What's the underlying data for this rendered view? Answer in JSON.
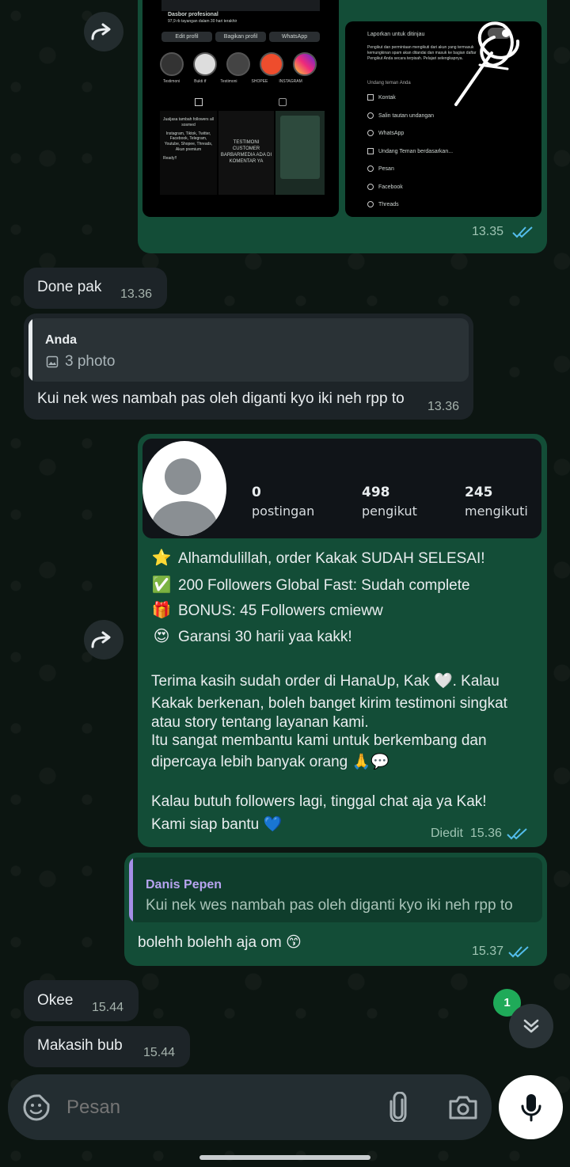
{
  "top_preview": {
    "left_thumb": {
      "header_title": "Dasbor profesional",
      "header_sub": "97,9 rb tayangan dalam 30 hari terakhir",
      "buttons": [
        "Edit profil",
        "Bagikan profil",
        "WhatsApp"
      ],
      "highlights": [
        "Testimoni",
        "Bukti tf",
        "Testimoni",
        "SHOPEE",
        "INSTAGRAM"
      ],
      "post_text_1": "Jualjasa tambah followers all sosmed",
      "post_text_2": "Instagram, Tiktok, Twitter, Facebook, Telegram, Youtube, Shopee, Threads, Akun premium",
      "post_text_3": "Ready!!",
      "post_text_4": "TESTIMONI CUSTOMER BARBARMEDIA ADA DI KOMENTAR YA"
    },
    "right_thumb": {
      "title": "Laporkan untuk ditinjau",
      "desc": "Pengikut dan permintaan mengikuti dari akun yang termasuk kemungkinan spam akan ditandai dan masuk ke bagian daftar Pengikut Anda secara terpisah. Pelajari selengkapnya.",
      "invite_title": "Undang teman Anda",
      "items": [
        "Kontak",
        "Salin tautan undangan",
        "WhatsApp",
        "Undang Teman berdasarkan...",
        "Pesan",
        "Facebook",
        "Threads"
      ]
    },
    "time": "13.35"
  },
  "messages": {
    "done": {
      "text": "Done pak",
      "time": "13.36"
    },
    "reply_in": {
      "quote_author": "Anda",
      "quote_text": "3 photo",
      "text": "Kui nek wes nambah pas oleh diganti kyo iki neh rpp to",
      "time": "13.36"
    },
    "order": {
      "profile": {
        "posts_num": "0",
        "posts_label": "postingan",
        "followers_num": "498",
        "followers_label": "pengikut",
        "following_num": "245",
        "following_label": "mengikuti"
      },
      "lines": [
        {
          "emoji": "⭐",
          "text": "Alhamdulillah, order Kakak SUDAH SELESAI!"
        },
        {
          "emoji": "✅",
          "text": "200 Followers Global Fast: Sudah complete"
        },
        {
          "emoji": "🎁",
          "text": "BONUS: 45 Followers cmieww"
        },
        {
          "emoji": "😍",
          "text": "Garansi 30 harii yaa kakk!"
        }
      ],
      "para1_l1": "Terima kasih sudah order di HanaUp, Kak 🤍. Kalau",
      "para1_l2": "Kakak berkenan, boleh banget kirim testimoni singkat",
      "para1_l3": "atau story tentang layanan kami.",
      "para1_l4": "Itu sangat membantu kami untuk berkembang dan",
      "para1_l5": "dipercaya lebih banyak orang 🙏💬",
      "para2_l1": "Kalau butuh followers lagi, tinggal chat aja ya Kak!",
      "para2_l2": "Kami siap bantu 💙",
      "edited": "Diedit",
      "time": "15.36"
    },
    "reply_out": {
      "quote_author": "Danis Pepen",
      "quote_text": "Kui nek wes nambah pas oleh diganti kyo iki neh rpp to",
      "text": "bolehh bolehh aja om 😙",
      "time": "15.37"
    },
    "okee": {
      "text": "Okee",
      "time": "15.44"
    },
    "makasih": {
      "text": "Makasih bub",
      "time": "15.44"
    }
  },
  "unread_badge": "1",
  "input": {
    "placeholder": "Pesan"
  },
  "colors": {
    "outgoing_bubble": "#134d37",
    "incoming_bubble": "#1d2428",
    "read_ticks": "#53bdeb",
    "badge": "#1faa59"
  }
}
